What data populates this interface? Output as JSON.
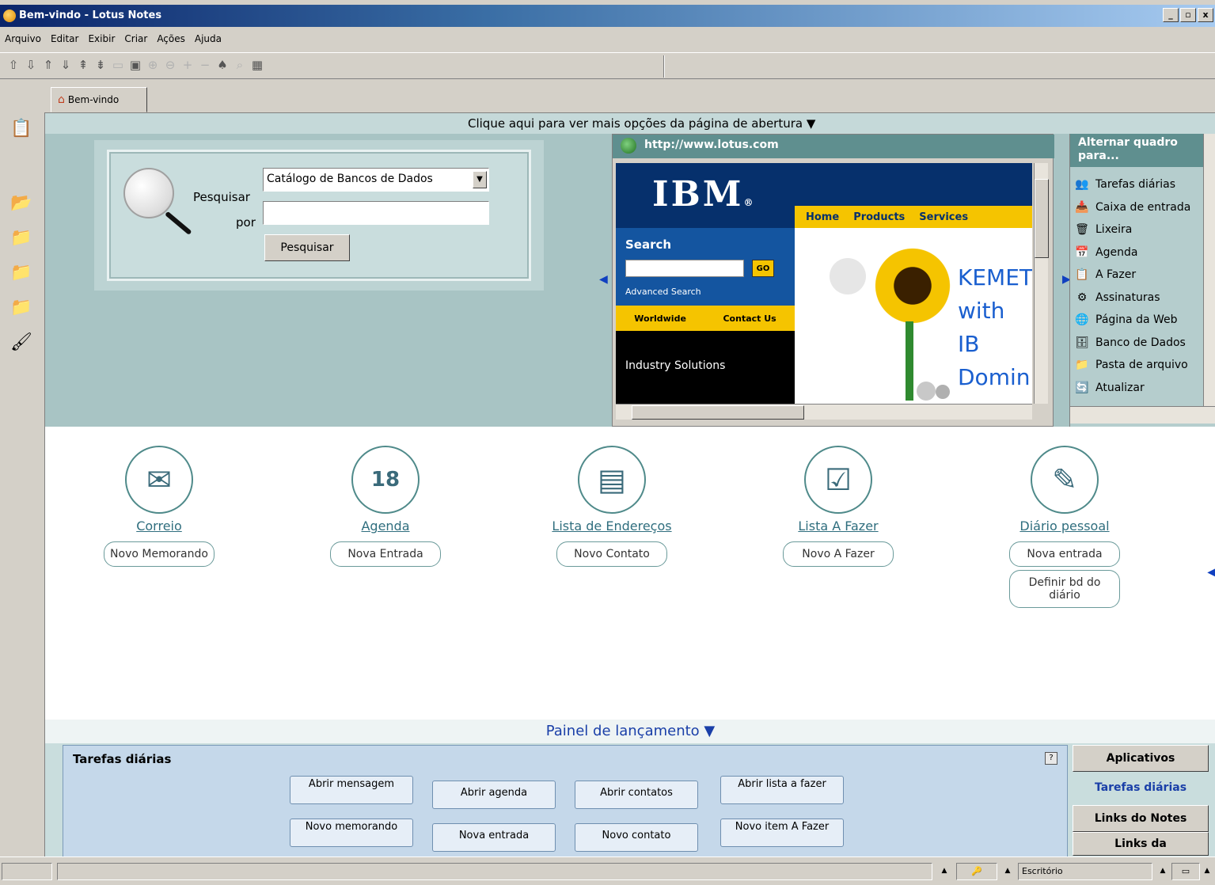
{
  "window": {
    "title": "Bem-vindo - Lotus Notes",
    "controls": {
      "minimize": "_",
      "maximize": "&#9633;",
      "close": "x"
    }
  },
  "menu": [
    "Arquivo",
    "Editar",
    "Exibir",
    "Criar",
    "Ações",
    "Ajuda"
  ],
  "tab": {
    "label": "Bem-vindo"
  },
  "options_link": "Clique aqui para ver mais opções da página de abertura ▼",
  "search": {
    "label_search": "Pesquisar",
    "label_by": "por",
    "catalog_selected": "Catálogo de Bancos de Dados",
    "query_value": "",
    "button": "Pesquisar"
  },
  "web": {
    "url": "http://www.lotus.com",
    "ibm_logo": "IBM",
    "ibm_logo_mark": "®",
    "search_label": "Search",
    "go_label": "GO",
    "advanced_search": "Advanced Search",
    "worldwide": "Worldwide",
    "contact_us": "Contact Us",
    "nav": [
      "Home",
      "Products",
      "Services"
    ],
    "industry_solutions": "Industry Solutions",
    "headline_lines": [
      "KEMET",
      "with IB",
      "Domin"
    ]
  },
  "quick": {
    "header": "Alternar quadro para...",
    "items": [
      {
        "label": "Tarefas diárias",
        "icon": "people-icon"
      },
      {
        "label": "Caixa de entrada",
        "icon": "inbox-icon"
      },
      {
        "label": "Lixeira",
        "icon": "trash-icon"
      },
      {
        "label": "Agenda",
        "icon": "calendar-icon"
      },
      {
        "label": "A Fazer",
        "icon": "todo-icon"
      },
      {
        "label": "Assinaturas",
        "icon": "subscription-icon"
      },
      {
        "label": "Página da Web",
        "icon": "globe-icon"
      },
      {
        "label": "Banco de Dados",
        "icon": "database-icon"
      },
      {
        "label": "Pasta de arquivo",
        "icon": "folder-icon"
      },
      {
        "label": "Atualizar",
        "icon": "refresh-icon"
      }
    ]
  },
  "features": [
    {
      "name": "correio",
      "icon": "mail-icon",
      "glyph": "✉",
      "link": "Correio",
      "buttons": [
        "Novo Memorando"
      ]
    },
    {
      "name": "agenda",
      "icon": "calendar-icon",
      "glyph": "18",
      "link": "Agenda",
      "buttons": [
        "Nova Entrada"
      ]
    },
    {
      "name": "enderecos",
      "icon": "address-book-icon",
      "glyph": "▤",
      "link": "Lista de Endereços",
      "buttons": [
        "Novo Contato"
      ]
    },
    {
      "name": "afazer",
      "icon": "clipboard-icon",
      "glyph": "☑",
      "link": "Lista A Fazer",
      "buttons": [
        "Novo A Fazer"
      ]
    },
    {
      "name": "diario",
      "icon": "journal-icon",
      "glyph": "✎",
      "link": "Diário pessoal",
      "buttons": [
        "Nova entrada",
        "Definir bd do diário"
      ]
    }
  ],
  "launch": {
    "title": "Painel de lançamento ▼",
    "tasks_title": "Tarefas diárias",
    "help": "?",
    "tasks_row1": [
      "Abrir mensagem",
      "Abrir agenda",
      "Abrir contatos",
      "Abrir lista a fazer"
    ],
    "tasks_row2": [
      "Novo memorando",
      "Nova entrada",
      "Novo contato",
      "Novo item A Fazer"
    ],
    "side_tabs": [
      "Aplicativos",
      "Tarefas diárias",
      "Links do Notes",
      "Links da"
    ]
  },
  "status": {
    "location": "Escritório"
  }
}
